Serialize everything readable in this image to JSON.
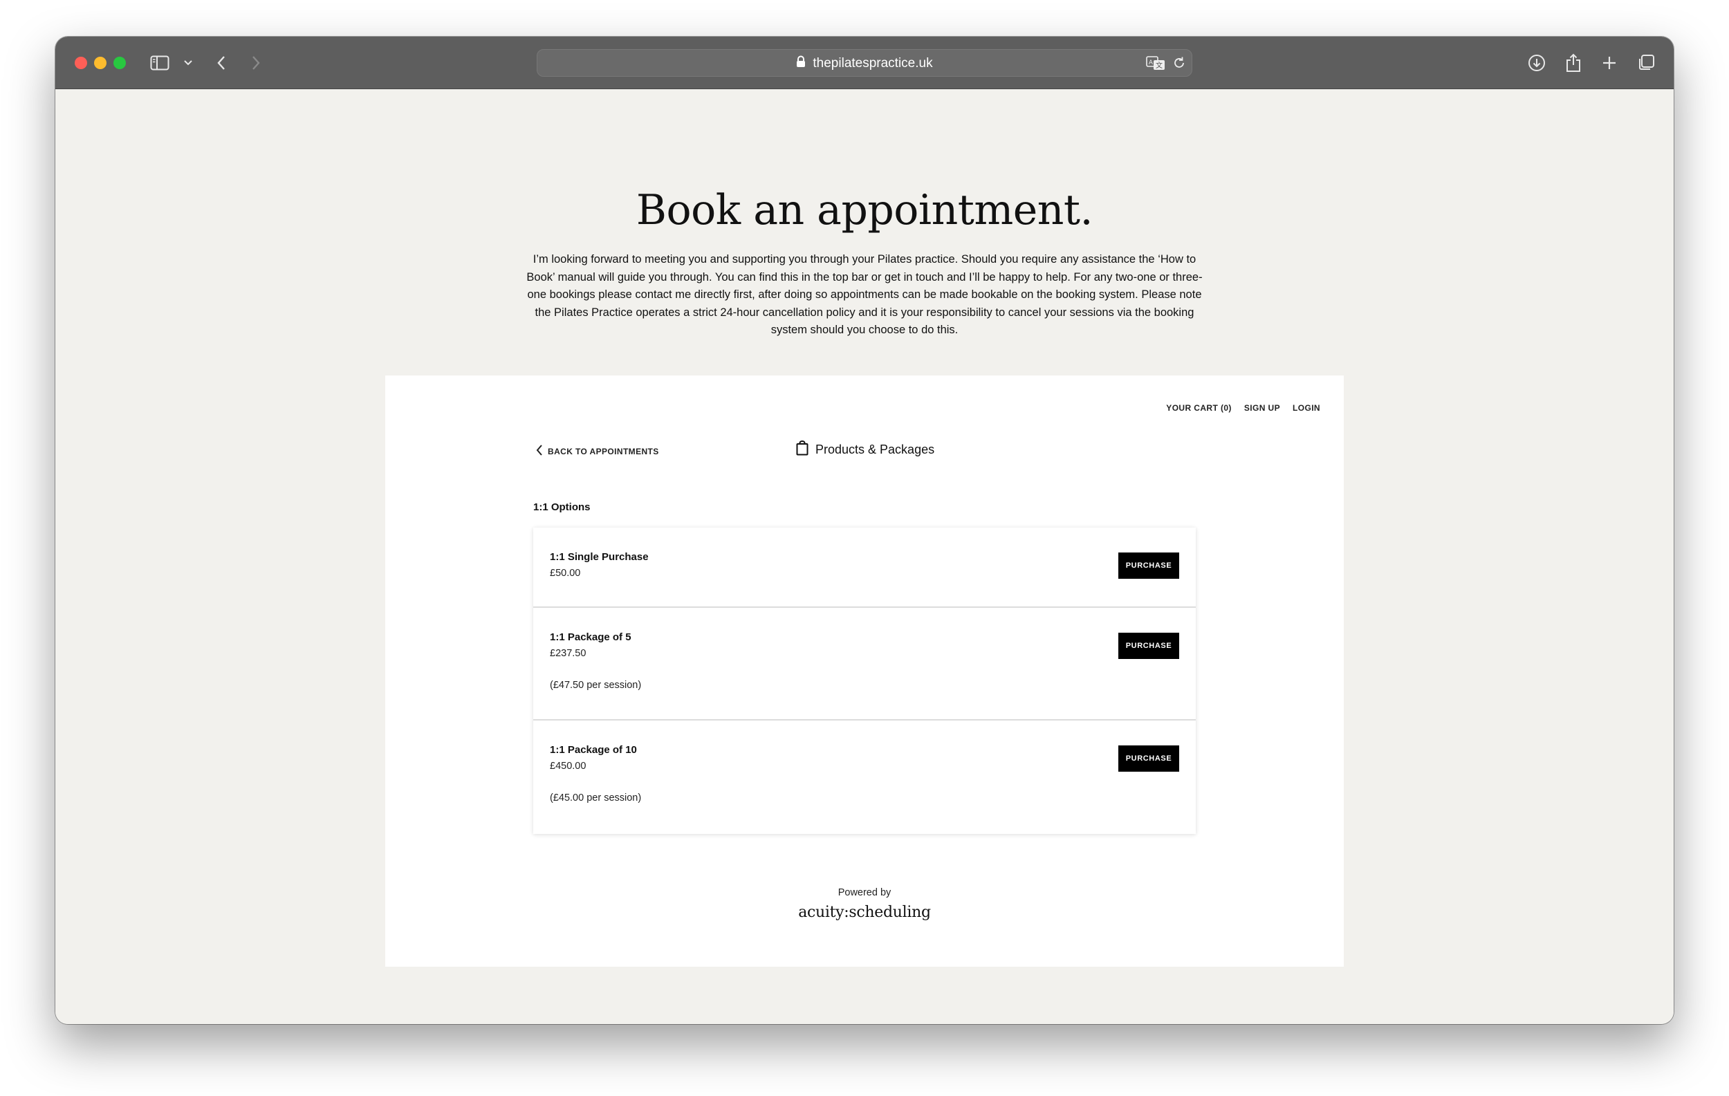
{
  "browser": {
    "url": "thepilatespractice.uk",
    "icons": [
      "sidebar-icon",
      "chevron-down-icon",
      "back-icon",
      "forward-icon",
      "lock-icon",
      "translate-icon",
      "reload-icon",
      "download-icon",
      "share-icon",
      "new-tab-icon",
      "tabs-overview-icon"
    ]
  },
  "page": {
    "title": "Book an appointment.",
    "intro": "I’m looking forward to meeting you and supporting you through your Pilates practice. Should you require any assistance the ‘How to Book’ manual will guide you through. You can find this in the top bar or get in touch and I’ll be happy to help. For any two-one or three-one bookings please contact me directly first, after doing so appointments can be made bookable on the booking system. Please note the Pilates Practice operates a strict 24-hour cancellation policy and it is your responsibility to cancel your sessions via the booking system should you choose to do this."
  },
  "scheduler": {
    "nav": {
      "cart": "YOUR CART (0)",
      "signup": "SIGN UP",
      "login": "LOGIN"
    },
    "back_label": "BACK TO APPOINTMENTS",
    "section_title": "Products & Packages",
    "group_label": "1:1 Options",
    "products": [
      {
        "name": "1:1 Single Purchase",
        "price": "£50.00",
        "note": "",
        "button": "PURCHASE"
      },
      {
        "name": "1:1 Package of 5",
        "price": "£237.50",
        "note": "(£47.50 per session)",
        "button": "PURCHASE"
      },
      {
        "name": "1:1 Package of 10",
        "price": "£450.00",
        "note": "(£45.00 per session)",
        "button": "PURCHASE"
      }
    ],
    "powered_by": "Powered by",
    "brand": "acuity:scheduling"
  },
  "colors": {
    "toolbar": "#5e5e5e",
    "page_background": "#f2f1ed",
    "button": "#000000",
    "button_text": "#ffffff"
  }
}
